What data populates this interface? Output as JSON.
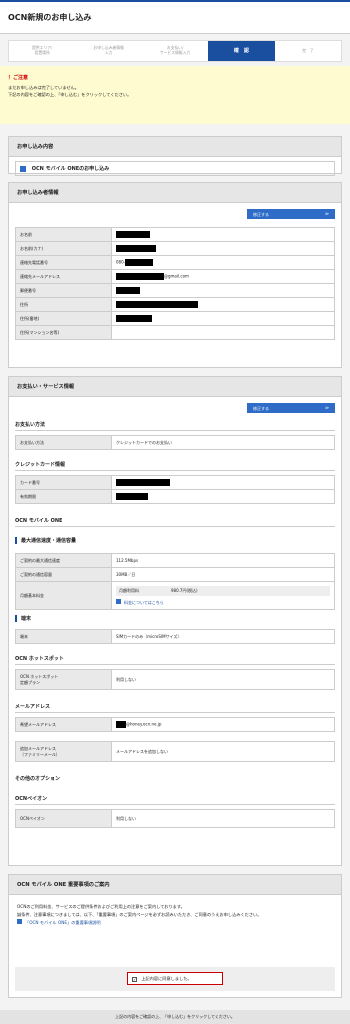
{
  "page_title": "OCN新規のお申し込み",
  "steps": [
    {
      "label": "提供エリア/\n設置場所"
    },
    {
      "label": "お申し込み者情報\n入力"
    },
    {
      "label": "お支払い/\nサービス情報入力"
    },
    {
      "label": "確　認"
    },
    {
      "label": "完　了"
    }
  ],
  "notice": {
    "title": "！ご注意",
    "line1": "まだお申し込みは完了していません。",
    "line2": "下記の内容をご確認の上、「申し込む」をクリックしてください。"
  },
  "order": {
    "heading": "お申し込み内容",
    "item": "OCN モバイル ONEのお申し込み"
  },
  "applicant": {
    "heading": "お申し込み者情報",
    "edit": "修正する",
    "rows": [
      {
        "k": "お名前",
        "v": ""
      },
      {
        "k": "お名前(カナ)",
        "v": ""
      },
      {
        "k": "連絡先電話番号",
        "v": "080-"
      },
      {
        "k": "連絡先メールアドレス",
        "v": "@gmail.com"
      },
      {
        "k": "郵便番号",
        "v": ""
      },
      {
        "k": "住所",
        "v": ""
      },
      {
        "k": "住所(番地)",
        "v": ""
      },
      {
        "k": "住所(マンション名等)",
        "v": ""
      }
    ]
  },
  "payment": {
    "heading": "お支払い・サービス情報",
    "edit": "修正する",
    "method_title": "お支払い方法",
    "method_k": "お支払い方法",
    "method_v": "クレジットカードでのお支払い",
    "card_title": "クレジットカード情報",
    "card_no_k": "カード番号",
    "card_exp_k": "有効期限",
    "ocn_title": "OCN モバイル ONE",
    "speed_title": "最大通信速度・通信容量",
    "speed_k": "ご契約の最大通信速度",
    "speed_v": "112.5Mbps",
    "cap_k": "ご契約の通信容量",
    "cap_v": "30MB／日",
    "fee_k": "月額基本料金",
    "fee_label": "月額利用料",
    "fee_v": "980.7円(税込)",
    "fee_link": "料金についてはこちら",
    "device_title": "端末",
    "device_k": "端末",
    "device_v": "SIMカードのみ（microSIMサイズ）",
    "hotspot_title": "OCN ホットスポット",
    "hotspot_k": "OCN ホットスポット\n定額プラン",
    "hotspot_v": "利用しない",
    "mail_title": "メールアドレス",
    "mail_k": "希望メールアドレス",
    "mail_v": "@honey.ocn.ne.jp",
    "mail_add_k": "追加メールアドレス\n（ファミリーメール）",
    "mail_add_v": "メールアドレスを追加しない",
    "other_title": "その他のオプション",
    "payon_title": "OCNペイオン",
    "payon_k": "OCNペイオン",
    "payon_v": "利用しない"
  },
  "important": {
    "heading": "OCN モバイル ONE 重要事項のご案内",
    "line1": "OCNのご利用料金、サービスのご提供条件およびご利用上の注意をご案内しております。",
    "line2": "誠条件、注意事項につきましては、以下、「重要事項」のご案内ページを必ずお読みいただき、ご同意のうえお申し込みください。",
    "link": "「OCN モバイル ONE」の重要事項説明",
    "agree": "上記内容に同意しました。"
  },
  "bottom": "上記の内容をご確認の上、「申し込む」をクリックしてください。",
  "colors": {
    "accent": "#1a4fa0",
    "notice_bg": "#fffbd1",
    "agree_border": "#cc0000"
  }
}
